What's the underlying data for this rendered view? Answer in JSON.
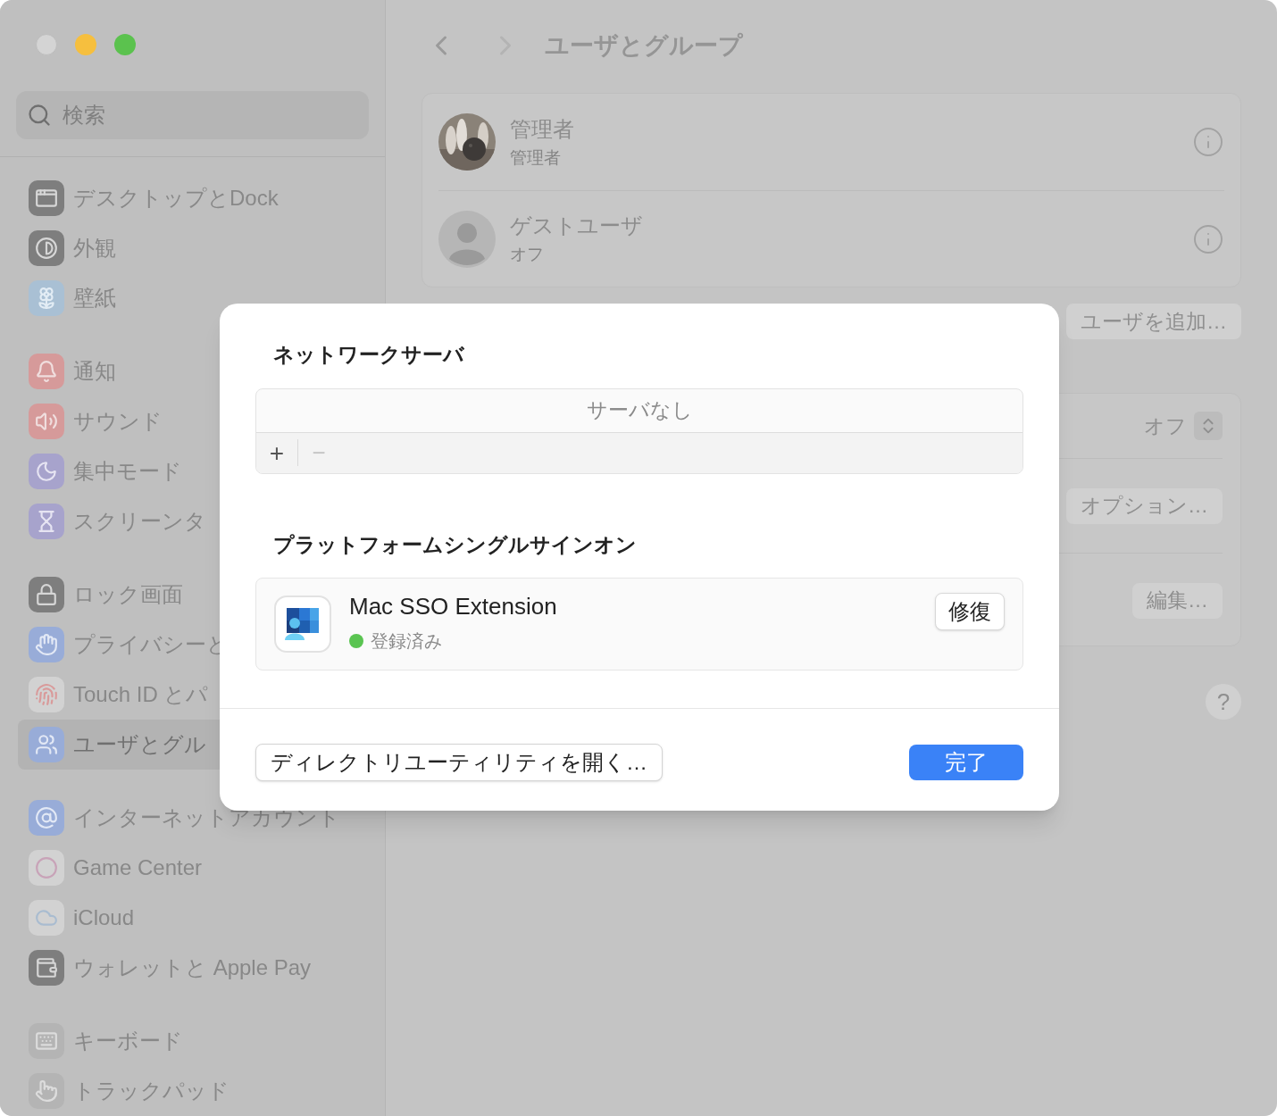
{
  "window": {
    "title": "ユーザとグループ"
  },
  "sidebar": {
    "search": {
      "placeholder": "検索"
    },
    "groups": [
      [
        {
          "label": "デスクトップとDock",
          "kind": "desktop",
          "selected": false
        },
        {
          "label": "外観",
          "kind": "appearance",
          "selected": false
        },
        {
          "label": "壁紙",
          "kind": "wallpaper",
          "selected": false
        }
      ],
      [
        {
          "label": "通知",
          "kind": "notifications",
          "selected": false
        },
        {
          "label": "サウンド",
          "kind": "sound",
          "selected": false
        },
        {
          "label": "集中モード",
          "kind": "focus",
          "selected": false
        },
        {
          "label": "スクリーンタ",
          "kind": "screentime",
          "selected": false
        }
      ],
      [
        {
          "label": "ロック画面",
          "kind": "lock",
          "selected": false
        },
        {
          "label": "プライバシーと",
          "kind": "privacy",
          "selected": false
        },
        {
          "label": "Touch ID とパ",
          "kind": "touchid",
          "selected": false
        },
        {
          "label": "ユーザとグル",
          "kind": "users",
          "selected": true
        }
      ],
      [
        {
          "label": "インターネットアカウント",
          "kind": "internet",
          "selected": false
        },
        {
          "label": "Game Center",
          "kind": "gamecenter",
          "selected": false
        },
        {
          "label": "iCloud",
          "kind": "icloud",
          "selected": false
        },
        {
          "label": "ウォレットと Apple Pay",
          "kind": "wallet",
          "selected": false
        }
      ],
      [
        {
          "label": "キーボード",
          "kind": "keyboard",
          "selected": false
        },
        {
          "label": "トラックパッド",
          "kind": "trackpad",
          "selected": false
        }
      ]
    ]
  },
  "users": [
    {
      "name": "管理者",
      "role": "管理者",
      "kind": "picture"
    },
    {
      "name": "ゲストユーザ",
      "role": "オフ",
      "kind": "silhouette"
    }
  ],
  "add_user_button": "ユーザを追加…",
  "settings_rows": [
    {
      "kind": "popup",
      "value": "オフ"
    },
    {
      "kind": "button",
      "label": "オプション…"
    },
    {
      "kind": "button",
      "label": "編集…"
    }
  ],
  "help_button": "?",
  "dialog": {
    "network_servers": {
      "title": "ネットワークサーバ",
      "empty_text": "サーバなし",
      "add_button": "+",
      "remove_button": "−",
      "remove_disabled": true
    },
    "sso": {
      "title": "プラットフォームシングルサインオン",
      "name": "Mac SSO Extension",
      "status": "登録済み",
      "color": "#5ac451",
      "repair_button": "修復"
    },
    "directory_button": "ディレクトリユーティリティを開く…",
    "done_button": "完了"
  }
}
